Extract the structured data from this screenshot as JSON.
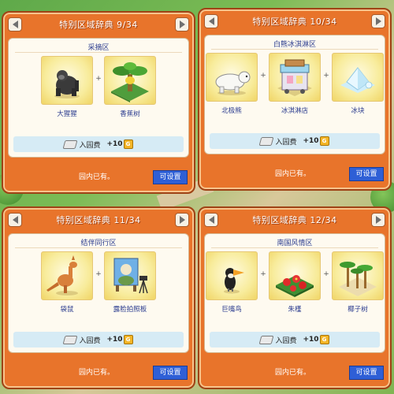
{
  "panels": [
    {
      "title": "特别区域辞典 9/34",
      "area": "采摘区",
      "items": [
        {
          "label": "大猩猩",
          "icon": "gorilla-icon"
        },
        {
          "label": "香蕉树",
          "icon": "banana-tree-icon"
        }
      ],
      "fee_label": "入园费",
      "fee_value": "+10",
      "currency": "G",
      "status": "园内已有。",
      "button": "可设置"
    },
    {
      "title": "特别区域辞典 10/34",
      "area": "白熊冰淇淋区",
      "items": [
        {
          "label": "北极熊",
          "icon": "polar-bear-icon"
        },
        {
          "label": "冰淇淋店",
          "icon": "ice-cream-shop-icon"
        },
        {
          "label": "冰块",
          "icon": "ice-block-icon"
        }
      ],
      "fee_label": "入园费",
      "fee_value": "+10",
      "currency": "G",
      "status": "园内已有。",
      "button": "可设置"
    },
    {
      "title": "特别区域辞典 11/34",
      "area": "结伴同行区",
      "items": [
        {
          "label": "袋鼠",
          "icon": "kangaroo-icon"
        },
        {
          "label": "露脸拍照板",
          "icon": "photo-board-icon"
        }
      ],
      "fee_label": "入园费",
      "fee_value": "+10",
      "currency": "G",
      "status": "园内已有。",
      "button": "可设置"
    },
    {
      "title": "特别区域辞典 12/34",
      "area": "南国风情区",
      "items": [
        {
          "label": "巨嘴鸟",
          "icon": "toucan-icon"
        },
        {
          "label": "朱槿",
          "icon": "hibiscus-icon"
        },
        {
          "label": "椰子树",
          "icon": "palm-tree-icon"
        }
      ],
      "fee_label": "入园费",
      "fee_value": "+10",
      "currency": "G",
      "status": "园内已有。",
      "button": "可设置"
    }
  ],
  "colors": {
    "panel_orange": "#e8742b",
    "button_blue": "#2e5fd6",
    "label_blue": "#2b3c8f",
    "fee_bar": "#d6ebf5"
  }
}
